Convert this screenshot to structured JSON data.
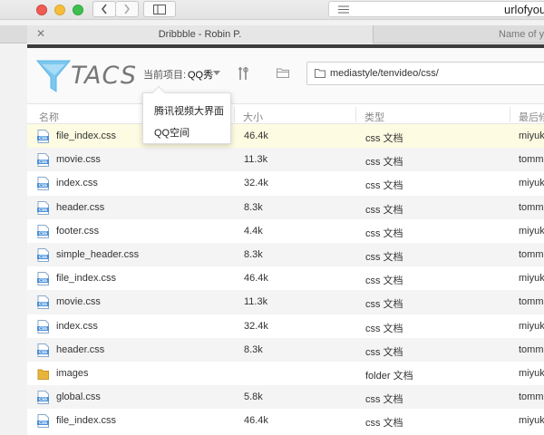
{
  "browser": {
    "url": "urlofyou",
    "tabs": [
      {
        "title": "Dribbble  -  Robin P."
      },
      {
        "title": "Name of y"
      }
    ]
  },
  "app": {
    "logo_text": "TACS",
    "project_label": "当前项目:",
    "project_value": "QQ秀",
    "path": "mediastyle/tenvideo/css/",
    "dropdown_items": [
      "腾讯视频大界面",
      "QQ空间"
    ]
  },
  "table": {
    "headers": [
      "名称",
      "大小",
      "类型",
      "最后修"
    ],
    "rows": [
      {
        "name": "file_index.css",
        "size": "46.4k",
        "type": "css 文档",
        "modifier": "miyuki",
        "icon": "css-file-icon",
        "selected": true
      },
      {
        "name": "movie.css",
        "size": "11.3k",
        "type": "css 文档",
        "modifier": "tomm",
        "icon": "css-file-icon"
      },
      {
        "name": "index.css",
        "size": "32.4k",
        "type": "css 文档",
        "modifier": "miyuki",
        "icon": "css-file-icon"
      },
      {
        "name": "header.css",
        "size": "8.3k",
        "type": "css 文档",
        "modifier": "tomm",
        "icon": "css-file-icon"
      },
      {
        "name": "footer.css",
        "size": "4.4k",
        "type": "css 文档",
        "modifier": "miyuki",
        "icon": "css-file-icon"
      },
      {
        "name": "simple_header.css",
        "size": "8.3k",
        "type": "css 文档",
        "modifier": "tomm",
        "icon": "css-file-icon"
      },
      {
        "name": "file_index.css",
        "size": "46.4k",
        "type": "css 文档",
        "modifier": "miyuki",
        "icon": "css-file-icon"
      },
      {
        "name": "movie.css",
        "size": "11.3k",
        "type": "css 文档",
        "modifier": "tomm",
        "icon": "css-file-icon"
      },
      {
        "name": "index.css",
        "size": "32.4k",
        "type": "css 文档",
        "modifier": "miyuki",
        "icon": "css-file-icon"
      },
      {
        "name": "header.css",
        "size": "8.3k",
        "type": "css 文档",
        "modifier": "tomm",
        "icon": "css-file-icon"
      },
      {
        "name": "images",
        "size": "",
        "type": "folder 文档",
        "modifier": "miyuki",
        "icon": "folder-icon"
      },
      {
        "name": "global.css",
        "size": "5.8k",
        "type": "css 文档",
        "modifier": "tomm",
        "icon": "css-file-icon"
      },
      {
        "name": "file_index.css",
        "size": "46.4k",
        "type": "css 文档",
        "modifier": "miyuki",
        "icon": "css-file-icon"
      }
    ]
  },
  "colors": {
    "selected_row": "#fdfbe1",
    "logo_funnel": "#5bb6e8",
    "css_icon": "#4a90d9",
    "folder_icon": "#e8b53a"
  }
}
